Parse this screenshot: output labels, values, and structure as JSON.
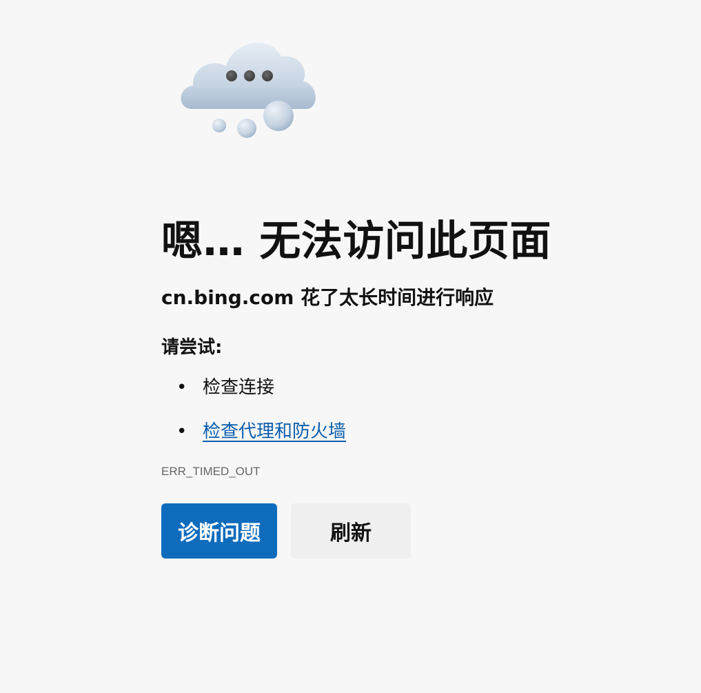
{
  "illustration": {
    "name": "cloud-with-dots-icon"
  },
  "error": {
    "headline": "嗯… 无法访问此页面",
    "message": "cn.bing.com 花了太长时间进行响应",
    "try_label": "请尝试:",
    "suggestions": [
      {
        "text": "检查连接",
        "is_link": false
      },
      {
        "text": "检查代理和防火墙",
        "is_link": true
      }
    ],
    "code": "ERR_TIMED_OUT"
  },
  "buttons": {
    "diagnose_label": "诊断问题",
    "refresh_label": "刷新"
  },
  "colors": {
    "background": "#f7f7f7",
    "primary": "#0f6cbd",
    "link": "#0b5cad",
    "secondary_button": "#efefef",
    "muted_text": "#666666"
  }
}
